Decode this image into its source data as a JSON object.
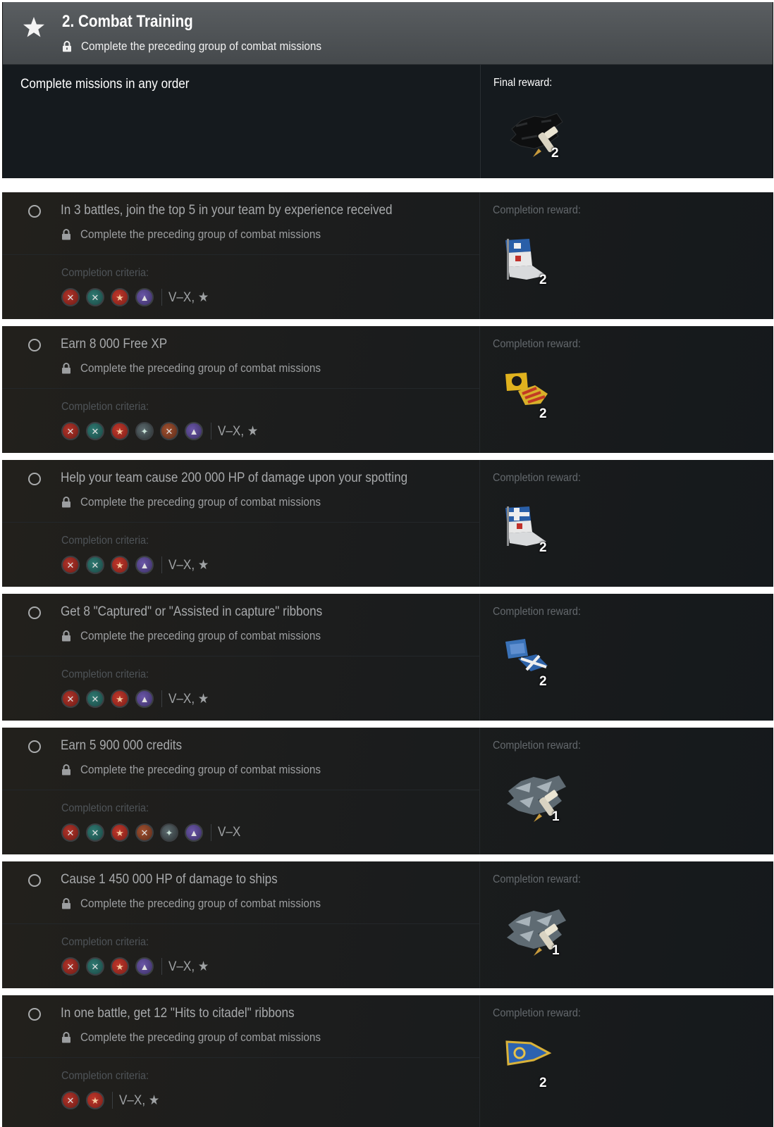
{
  "group": {
    "title": "2. Combat Training",
    "lock_text": "Complete the preceding group of combat missions",
    "instruction": "Complete missions in any order",
    "final_reward_label": "Final reward:",
    "final_reward": {
      "icon": "camouflage-icon",
      "count": "2"
    }
  },
  "labels": {
    "criteria": "Completion criteria:",
    "reward": "Completion reward:",
    "lock_text": "Complete the preceding group of combat missions"
  },
  "missions": [
    {
      "title": "In 3 battles, join the top 5 in your team by experience received",
      "tiers": "V–X, ★",
      "badges": [
        "red",
        "teal",
        "star",
        "purple"
      ],
      "reward_icon": "signal-flag-blue-white-icon",
      "reward_count": "2"
    },
    {
      "title": "Earn 8 000 Free XP",
      "tiers": "V–X, ★",
      "badges": [
        "red",
        "teal",
        "star",
        "grey",
        "orange",
        "purple"
      ],
      "reward_icon": "signal-flag-yellow-icon",
      "reward_count": "2"
    },
    {
      "title": "Help your team cause 200 000 HP of damage upon your spotting",
      "tiers": "V–X, ★",
      "badges": [
        "red",
        "teal",
        "star",
        "purple"
      ],
      "reward_icon": "signal-flag-white-cross-icon",
      "reward_count": "2"
    },
    {
      "title": "Get 8 \"Captured\" or \"Assisted in capture\" ribbons",
      "tiers": "V–X, ★",
      "badges": [
        "red",
        "teal",
        "star",
        "purple"
      ],
      "reward_icon": "signal-flag-blue-saltire-icon",
      "reward_count": "2"
    },
    {
      "title": "Earn 5 900 000 credits",
      "tiers": "V–X",
      "badges": [
        "red",
        "teal",
        "star",
        "orange",
        "grey",
        "purple"
      ],
      "reward_icon": "camouflage-grey-icon",
      "reward_count": "1"
    },
    {
      "title": "Cause 1 450 000 HP of damage to ships",
      "tiers": "V–X, ★",
      "badges": [
        "red",
        "teal",
        "star",
        "purple"
      ],
      "reward_icon": "camouflage-grey-icon",
      "reward_count": "1"
    },
    {
      "title": "In one battle, get 12 \"Hits to citadel\" ribbons",
      "tiers": "V–X, ★",
      "badges": [
        "red",
        "star"
      ],
      "reward_icon": "pennant-blue-icon",
      "reward_count": "2"
    }
  ]
}
